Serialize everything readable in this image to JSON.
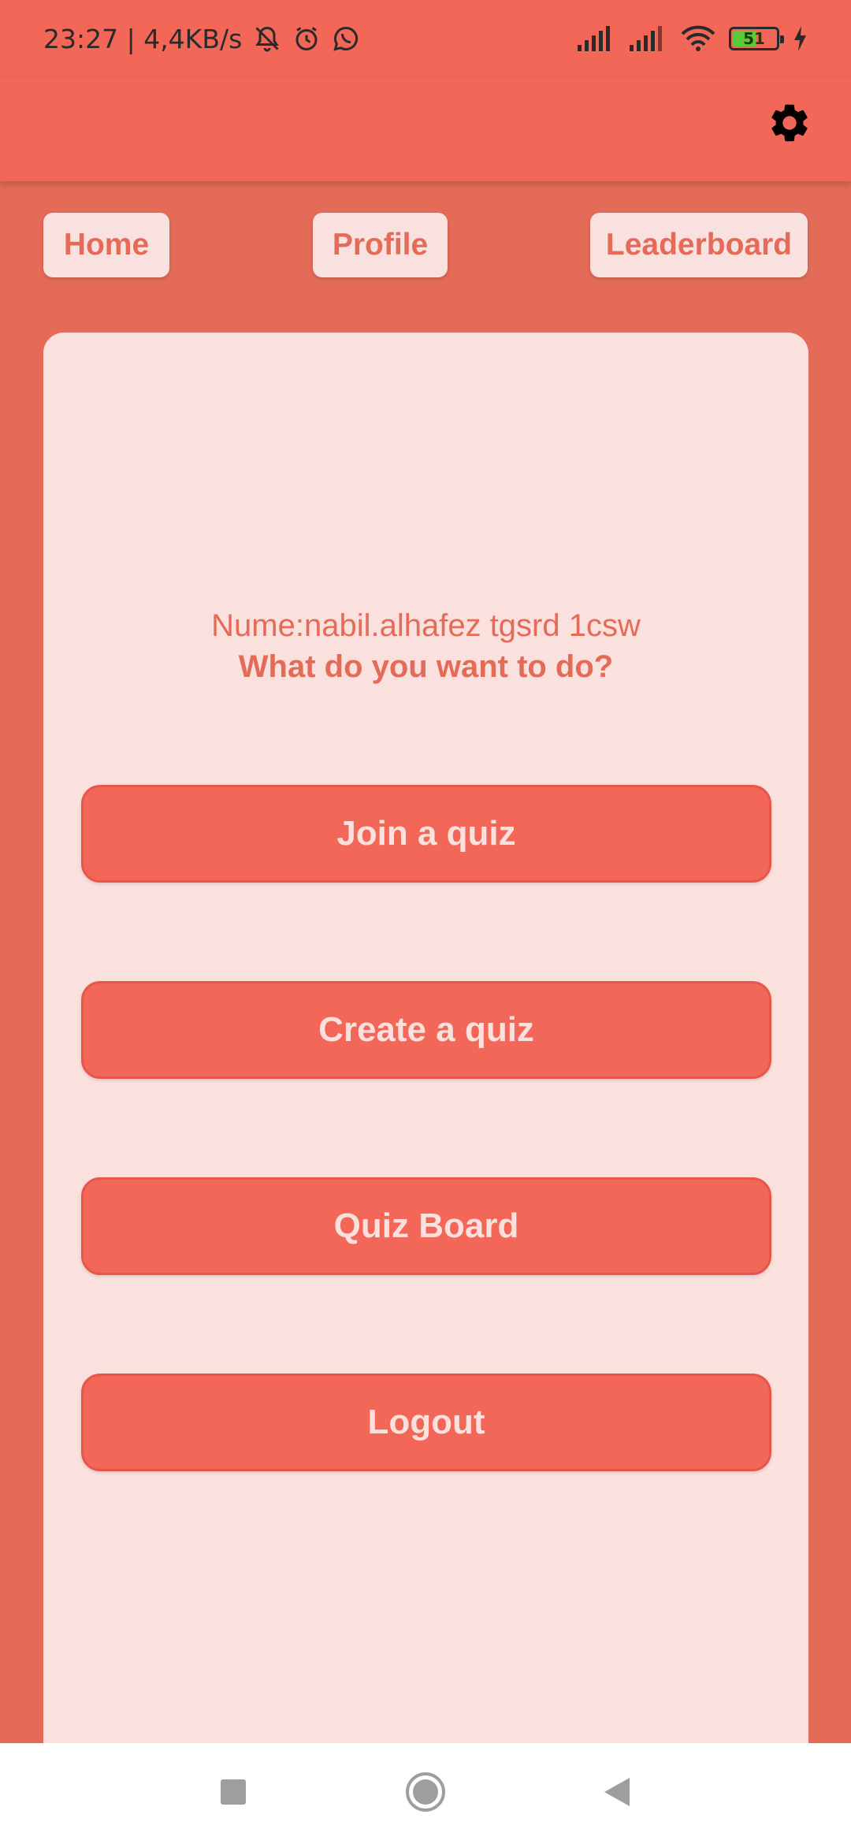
{
  "status_bar": {
    "time_speed": "23:27 | 4,4KB/s",
    "icons": [
      "bell-off-icon",
      "alarm-icon",
      "whatsapp-icon",
      "signal-icon",
      "signal-icon",
      "wifi-icon",
      "battery-icon",
      "charging-icon"
    ],
    "battery_level": "51"
  },
  "app_bar": {
    "settings_icon": "gear-icon"
  },
  "nav": {
    "home": "Home",
    "profile": "Profile",
    "leaderboard": "Leaderboard"
  },
  "card": {
    "greeting": "Nume:nabil.alhafez tgsrd 1csw",
    "question": "What do you want to do?"
  },
  "actions": {
    "join": "Join a quiz",
    "create": "Create a quiz",
    "board": "Quiz Board",
    "logout": "Logout"
  },
  "system_nav": {
    "recent_icon": "square-icon",
    "home_icon": "circle-home-icon",
    "back_icon": "triangle-back-icon"
  },
  "colors": {
    "app_bar": "#F26757",
    "background": "#E36B57",
    "card": "#FAE1DE",
    "button": "#F26757",
    "button_text": "#FAE1DE"
  }
}
